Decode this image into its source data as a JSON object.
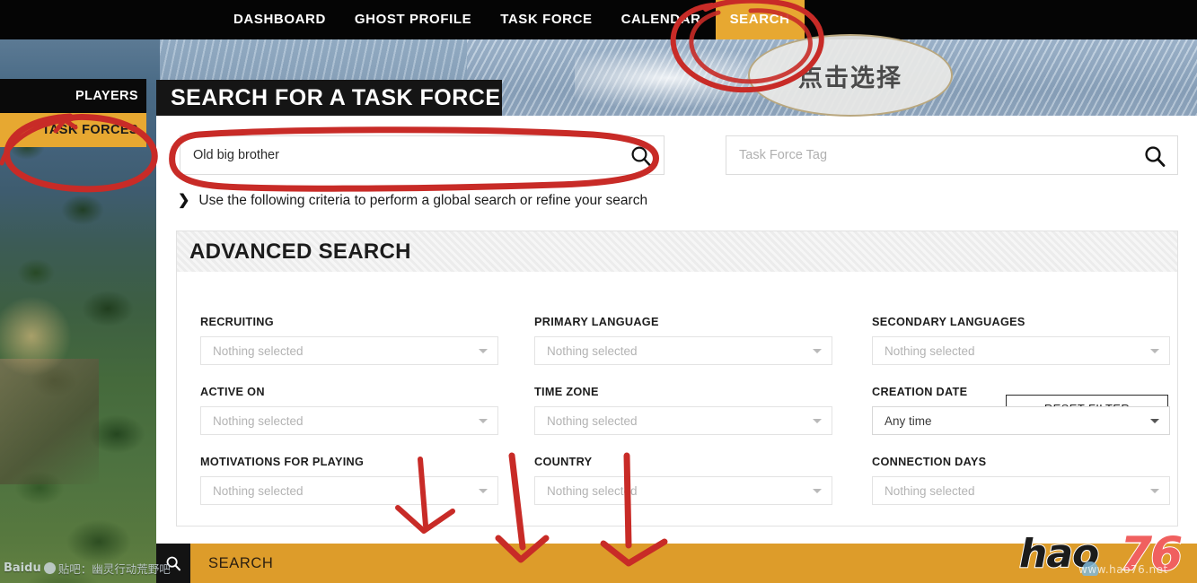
{
  "topnav": {
    "items": [
      {
        "label": "DASHBOARD",
        "active": false
      },
      {
        "label": "GHOST PROFILE",
        "active": false
      },
      {
        "label": "TASK FORCE",
        "active": false
      },
      {
        "label": "CALENDAR",
        "active": false
      },
      {
        "label": "SEARCH",
        "active": true
      }
    ]
  },
  "sidebar": {
    "players_label": "PLAYERS",
    "taskforces_label": "TASK FORCES"
  },
  "page": {
    "heading": "SEARCH FOR A TASK FORCE"
  },
  "search": {
    "name_value": "Old big brother",
    "name_placeholder": "",
    "tag_value": "",
    "tag_placeholder": "Task Force Tag",
    "search_icon": "magnifier-icon"
  },
  "criteria": {
    "chevron_icon": "chevron-down-icon",
    "text": "Use the following criteria to perform a global search or refine your search"
  },
  "advanced": {
    "title": "ADVANCED SEARCH",
    "reset_label": "RESET FILTER",
    "nothing_selected": "Nothing selected",
    "fields": [
      {
        "label": "RECRUITING",
        "value": "Nothing selected",
        "filled": false
      },
      {
        "label": "PRIMARY LANGUAGE",
        "value": "Nothing selected",
        "filled": false
      },
      {
        "label": "SECONDARY LANGUAGES",
        "value": "Nothing selected",
        "filled": false
      },
      {
        "label": "ACTIVE ON",
        "value": "Nothing selected",
        "filled": false
      },
      {
        "label": "TIME ZONE",
        "value": "Nothing selected",
        "filled": false
      },
      {
        "label": "CREATION DATE",
        "value": "Any time",
        "filled": true
      },
      {
        "label": "MOTIVATIONS FOR PLAYING",
        "value": "Nothing selected",
        "filled": false
      },
      {
        "label": "COUNTRY",
        "value": "Nothing selected",
        "filled": false
      },
      {
        "label": "CONNECTION DAYS",
        "value": "Nothing selected",
        "filled": false
      }
    ]
  },
  "bottom": {
    "search_label": "SEARCH",
    "icon": "magnifier-icon"
  },
  "callout": {
    "text": "点击选择"
  },
  "watermarks": {
    "baidu_brand": "Baidu",
    "baidu_tieba": "贴吧：幽灵行动荒野吧",
    "hao_text": "hao",
    "hao_num": "76",
    "hao_url": "www.hao76.net"
  },
  "colors": {
    "accent_orange": "#e7a831",
    "bottom_bar_orange": "#dd9c2a",
    "nav_black": "#050505",
    "annotation_red": "#cc2222"
  }
}
